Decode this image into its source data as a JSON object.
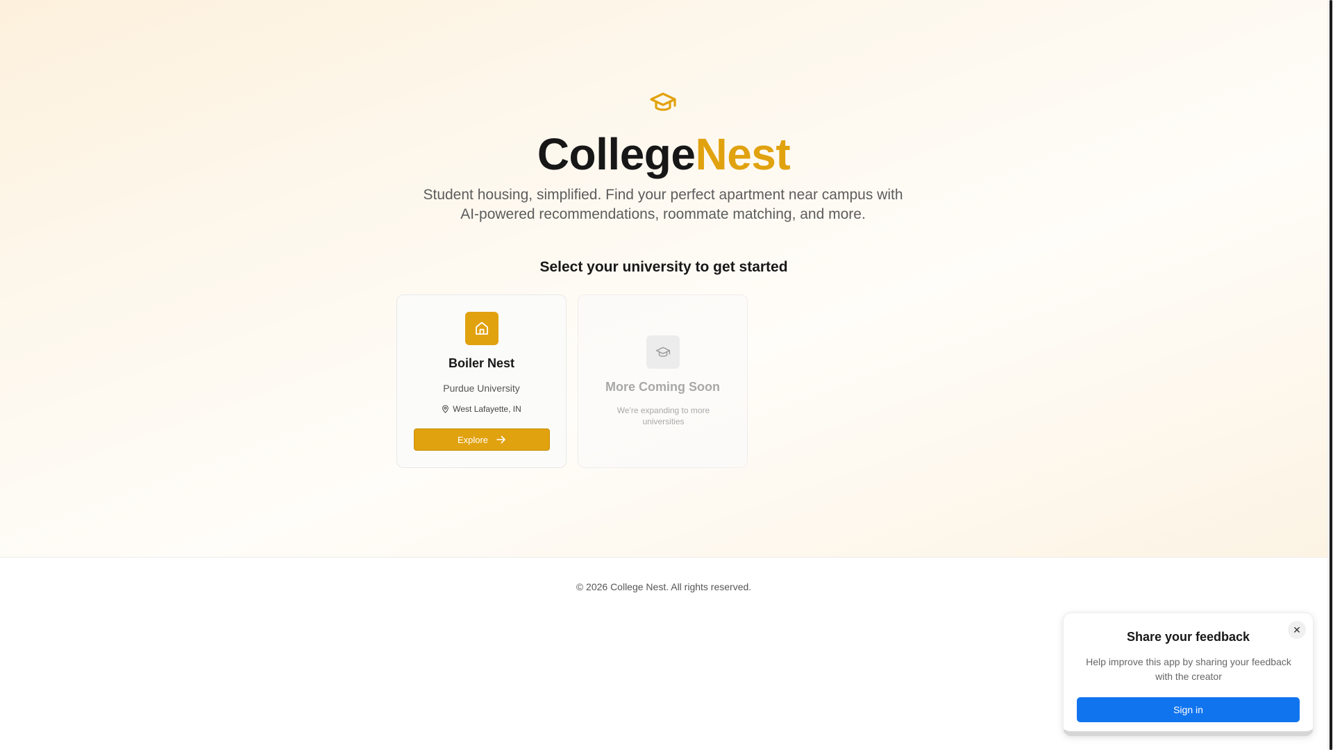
{
  "brand": {
    "part1": "College",
    "part2": "Nest"
  },
  "tagline": "Student housing, simplified. Find your perfect apartment near campus with AI-powered recommendations, roommate matching, and more.",
  "select_heading": "Select your university to get started",
  "cards": {
    "boiler": {
      "title": "Boiler Nest",
      "university": "Purdue University",
      "location": "West Lafayette, IN",
      "button_label": "Explore",
      "icon": "home-icon"
    },
    "soon": {
      "title": "More Coming Soon",
      "description": "We're expanding to more universities",
      "icon": "graduation-cap-icon"
    }
  },
  "footer": {
    "copyright": "© 2026 College Nest. All rights reserved."
  },
  "feedback": {
    "title": "Share your feedback",
    "description": "Help improve this app by sharing your feedback with the creator",
    "signin_label": "Sign in",
    "close_symbol": "✕"
  },
  "colors": {
    "accent": "#e1a20f",
    "primary_blue": "#1174ef"
  }
}
